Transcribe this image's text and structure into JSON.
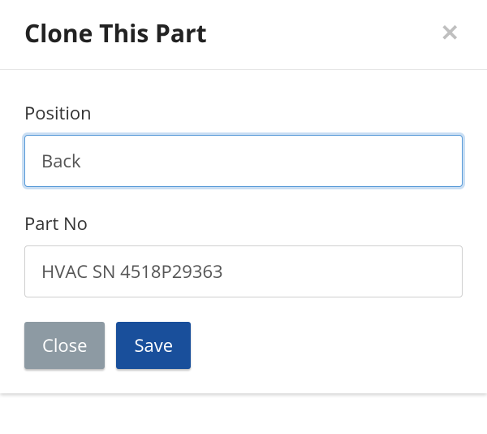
{
  "modal": {
    "title": "Clone This Part",
    "fields": {
      "position": {
        "label": "Position",
        "value": "Back"
      },
      "partNo": {
        "label": "Part No",
        "value": "HVAC SN 4518P29363"
      }
    },
    "buttons": {
      "close": "Close",
      "save": "Save"
    }
  }
}
